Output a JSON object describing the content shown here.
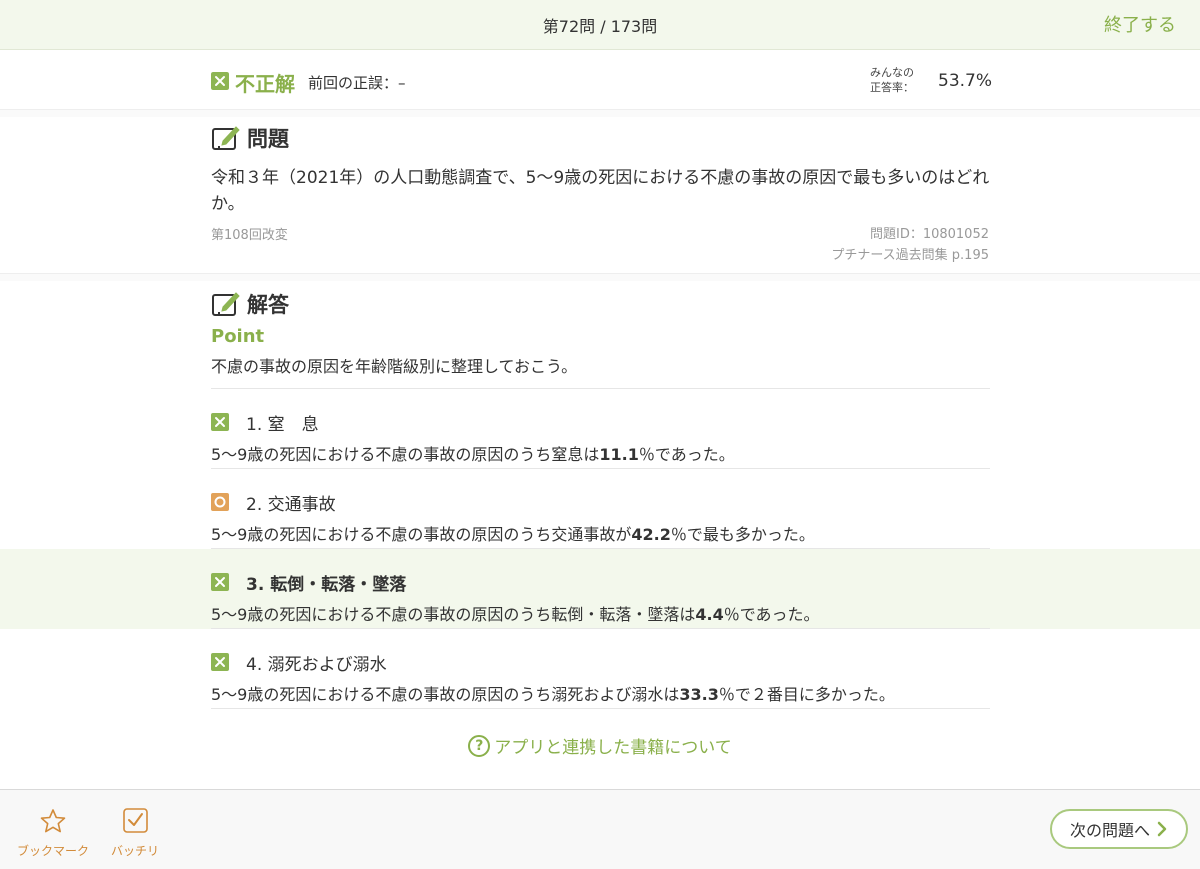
{
  "header": {
    "progress": "第72問 / 173問",
    "end_label": "終了する"
  },
  "result": {
    "verdict": "不正解",
    "previous": "前回の正誤：–",
    "rate_label_line1": "みんなの",
    "rate_label_line2": "正答率：",
    "rate_value": "53.7%"
  },
  "question": {
    "section_title": "問題",
    "text": "令和３年（2021年）の人口動態調査で、5〜9歳の死因における不慮の事故の原因で最も多いのはどれか。",
    "exam_label": "第108回改変",
    "question_id": "問題ID：10801052",
    "book_ref": "プチナース過去問集 p.195"
  },
  "answer": {
    "section_title": "解答",
    "point_label": "Point",
    "point_text": "不慮の事故の原因を年齢階級別に整理しておこう。",
    "choices": [
      {
        "title": "1. 窒　息",
        "mark": "x",
        "exp_before": "5〜9歳の死因における不慮の事故の原因のうち窒息は",
        "exp_value": "11.1",
        "exp_after": "％であった。"
      },
      {
        "title": "2. 交通事故",
        "mark": "o",
        "exp_before": "5〜9歳の死因における不慮の事故の原因のうち交通事故が",
        "exp_value": "42.2",
        "exp_after": "％で最も多かった。"
      },
      {
        "title": "3. 転倒・転落・墜落",
        "mark": "x",
        "exp_before": "5〜9歳の死因における不慮の事故の原因のうち転倒・転落・墜落は",
        "exp_value": "4.4",
        "exp_after": "％であった。"
      },
      {
        "title": "4. 溺死および溺水",
        "mark": "x",
        "exp_before": "5〜9歳の死因における不慮の事故の原因のうち溺死および溺水は",
        "exp_value": "33.3",
        "exp_after": "％で２番目に多かった。"
      }
    ],
    "linked_books_label": "アプリと連携した書籍について"
  },
  "footer": {
    "bookmark_label": "ブックマーク",
    "bacchiri_label": "バッチリ",
    "next_label": "次の問題へ"
  },
  "colors": {
    "accent_green": "#8ab04b",
    "wrong_mark": "#8db553",
    "correct_mark": "#e2a259",
    "tool_orange": "#d28b3a"
  }
}
